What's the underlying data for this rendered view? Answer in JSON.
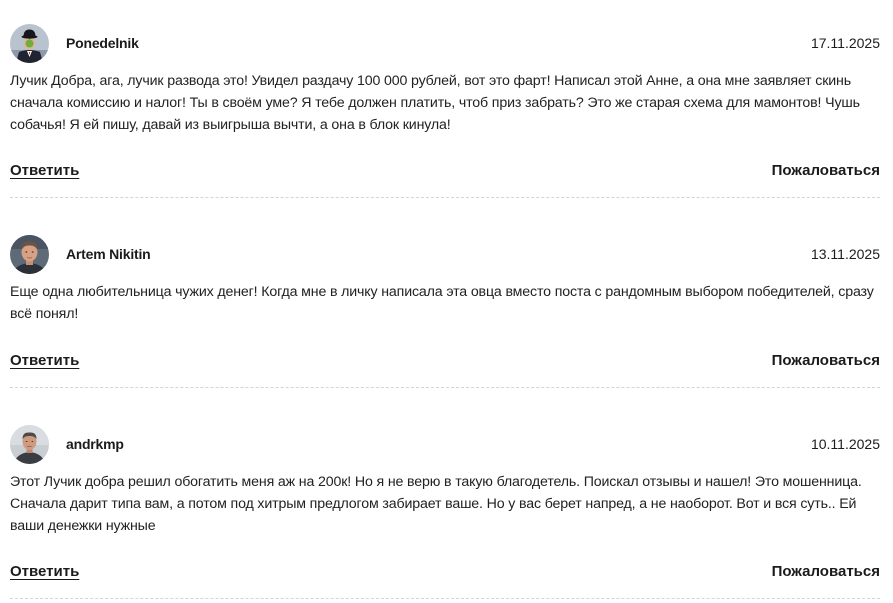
{
  "comments": [
    {
      "author": "Ponedelnik",
      "date": "17.11.2025",
      "text": "Лучик Добра, ага, лучик развода это! Увидел раздачу 100 000 рублей, вот это фарт! Написал этой Анне, а она мне заявляет скинь сначала комиссию и налог! Ты в своём уме? Я тебе должен платить, чтоб приз забрать? Это же старая схема для мамонтов! Чушь собачья! Я ей пишу, давай из выигрыша вычти, а она в блок кинула!",
      "reply_label": "Ответить",
      "complain_label": "Пожаловаться"
    },
    {
      "author": "Artem Nikitin",
      "date": "13.11.2025",
      "text": "Еще одна любительница чужих денег! Когда мне в личку написала эта овца вместо поста с рандомным выбором победителей, сразу всё понял!",
      "reply_label": "Ответить",
      "complain_label": "Пожаловаться"
    },
    {
      "author": "andrkmp",
      "date": "10.11.2025",
      "text": "Этот Лучик добра решил обогатить меня аж на 200к! Но я не верю в такую благодетель. Поискал отзывы и нашел! Это мошенница. Сначала дарит типа вам, а потом под хитрым предлогом забирает ваше. Но у вас берет напред, а не наоборот. Вот и вся суть.. Ей ваши денежки нужные",
      "reply_label": "Ответить",
      "complain_label": "Пожаловаться"
    }
  ]
}
